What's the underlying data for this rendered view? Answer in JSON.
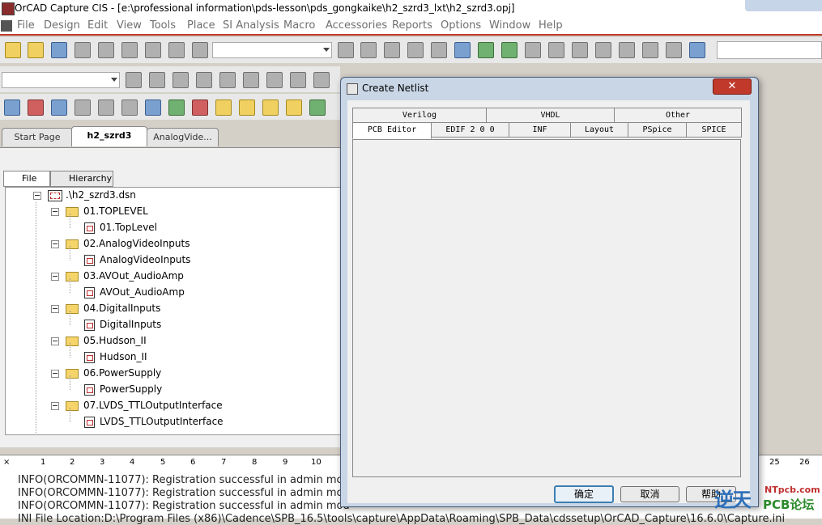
{
  "window": {
    "title": "OrCAD Capture CIS - [e:\\professional information\\pds-lesson\\pds_gongkaike\\h2_szrd3_lxt\\h2_szrd3.opj]"
  },
  "menu": [
    "File",
    "Design",
    "Edit",
    "View",
    "Tools",
    "Place",
    "SI Analysis",
    "Macro",
    "Accessories",
    "Reports",
    "Options",
    "Window",
    "Help"
  ],
  "doc_tabs": [
    "Start Page",
    "h2_szrd3",
    "AnalogVide..."
  ],
  "project_tabs": [
    "File",
    "Hierarchy"
  ],
  "tree": {
    "root": ".\\h2_szrd3.dsn",
    "folders": [
      {
        "name": "01.TOPLEVEL",
        "page": "01.TopLevel"
      },
      {
        "name": "02.AnalogVideoInputs",
        "page": "AnalogVideoInputs"
      },
      {
        "name": "03.AVOut_AudioAmp",
        "page": "AVOut_AudioAmp"
      },
      {
        "name": "04.DigitalInputs",
        "page": "DigitalInputs"
      },
      {
        "name": "05.Hudson_II",
        "page": "Hudson_II"
      },
      {
        "name": "06.PowerSupply",
        "page": "PowerSupply"
      },
      {
        "name": "07.LVDS_TTLOutputInterface",
        "page": "LVDS_TTLOutputInterface"
      }
    ]
  },
  "ruler": [
    "1",
    "2",
    "3",
    "4",
    "5",
    "6",
    "7",
    "8",
    "9",
    "10",
    "25",
    "26"
  ],
  "log": [
    "INFO(ORCOMMN-11077): Registration successful in admin mod",
    "INFO(ORCOMMN-11077): Registration successful in admin mod",
    "INFO(ORCOMMN-11077): Registration successful in admin mod",
    "INI File Location:D:\\Program Files (x86)\\Cadence\\SPB_16.5\\tools\\capture\\AppData\\Roaming\\SPB_Data\\cdssetup\\OrCAD_Capture\\16.6.0\\Capture.ini"
  ],
  "dialog": {
    "title": "Create Netlist",
    "close": "✕",
    "tabs_back": [
      "Verilog",
      "VHDL",
      "Other"
    ],
    "tabs_front": [
      "PCB Editor",
      "EDIF 2 0 0",
      "INF",
      "Layout",
      "PSpice",
      "SPICE"
    ],
    "ok": "确定",
    "cancel": "取消",
    "help": "帮助"
  },
  "watermark": {
    "big": "逆天",
    "top": "NTpcb.com",
    "bottom": "PCB论坛"
  }
}
